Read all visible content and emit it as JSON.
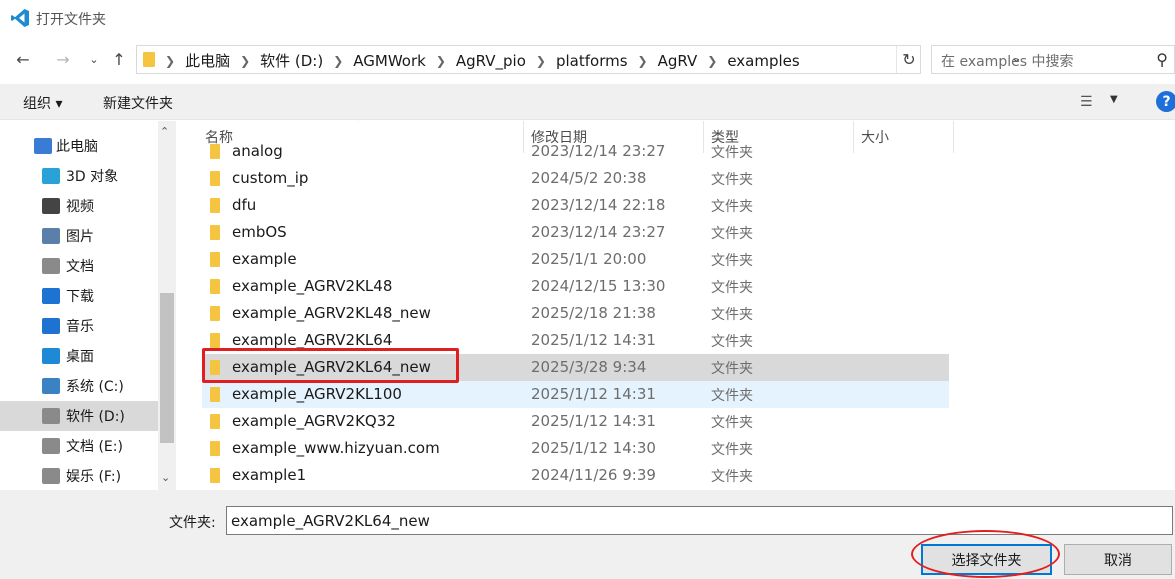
{
  "window": {
    "title": "打开文件夹"
  },
  "nav": {
    "path": [
      "此电脑",
      "软件 (D:)",
      "AGMWork",
      "AgRV_pio",
      "platforms",
      "AgRV",
      "examples"
    ],
    "search_placeholder": "在 examples 中搜索"
  },
  "toolbar": {
    "organize": "组织 ▾",
    "new_folder": "新建文件夹",
    "help": "?"
  },
  "sidebar": {
    "items": [
      {
        "label": "此电脑",
        "icon": "computer-icon",
        "color": "#3a7bd5"
      },
      {
        "label": "3D 对象",
        "icon": "cube-3d-icon",
        "color": "#29a3d6"
      },
      {
        "label": "视频",
        "icon": "film-icon",
        "color": "#444444"
      },
      {
        "label": "图片",
        "icon": "picture-icon",
        "color": "#5a7fa8"
      },
      {
        "label": "文档",
        "icon": "document-icon",
        "color": "#8a8a8a"
      },
      {
        "label": "下载",
        "icon": "download-icon",
        "color": "#1e73d2"
      },
      {
        "label": "音乐",
        "icon": "music-icon",
        "color": "#1e73d2"
      },
      {
        "label": "桌面",
        "icon": "desktop-icon",
        "color": "#1e8ad6"
      },
      {
        "label": "系统 (C:)",
        "icon": "windows-drive-icon",
        "color": "#3b82c4"
      },
      {
        "label": "软件 (D:)",
        "icon": "drive-icon",
        "color": "#8a8a8a",
        "selected": true
      },
      {
        "label": "文档 (E:)",
        "icon": "drive-icon",
        "color": "#8a8a8a"
      },
      {
        "label": "娱乐 (F:)",
        "icon": "drive-icon",
        "color": "#8a8a8a"
      }
    ]
  },
  "columns": {
    "name": "名称",
    "date": "修改日期",
    "type": "类型",
    "size": "大小"
  },
  "files": [
    {
      "name": "analog",
      "date": "2023/12/14 23:27",
      "type": "文件夹"
    },
    {
      "name": "custom_ip",
      "date": "2024/5/2 20:38",
      "type": "文件夹"
    },
    {
      "name": "dfu",
      "date": "2023/12/14 22:18",
      "type": "文件夹"
    },
    {
      "name": "embOS",
      "date": "2023/12/14 23:27",
      "type": "文件夹"
    },
    {
      "name": "example",
      "date": "2025/1/1 20:00",
      "type": "文件夹"
    },
    {
      "name": "example_AGRV2KL48",
      "date": "2024/12/15 13:30",
      "type": "文件夹"
    },
    {
      "name": "example_AGRV2KL48_new",
      "date": "2025/2/18 21:38",
      "type": "文件夹"
    },
    {
      "name": "example_AGRV2KL64",
      "date": "2025/1/12 14:31",
      "type": "文件夹"
    },
    {
      "name": "example_AGRV2KL64_new",
      "date": "2025/3/28 9:34",
      "type": "文件夹",
      "selected": true
    },
    {
      "name": "example_AGRV2KL100",
      "date": "2025/1/12 14:31",
      "type": "文件夹",
      "hover": true
    },
    {
      "name": "example_AGRV2KQ32",
      "date": "2025/1/12 14:31",
      "type": "文件夹"
    },
    {
      "name": "example_www.hizyuan.com",
      "date": "2025/1/12 14:30",
      "type": "文件夹"
    },
    {
      "name": "example1",
      "date": "2024/11/26 9:39",
      "type": "文件夹"
    }
  ],
  "footer": {
    "folder_label": "文件夹:",
    "folder_value": "example_AGRV2KL64_new",
    "select_button": "选择文件夹",
    "cancel_button": "取消"
  },
  "colors": {
    "accent": "#0078d7",
    "annotation": "#e02020",
    "folder": "#f5c542"
  }
}
